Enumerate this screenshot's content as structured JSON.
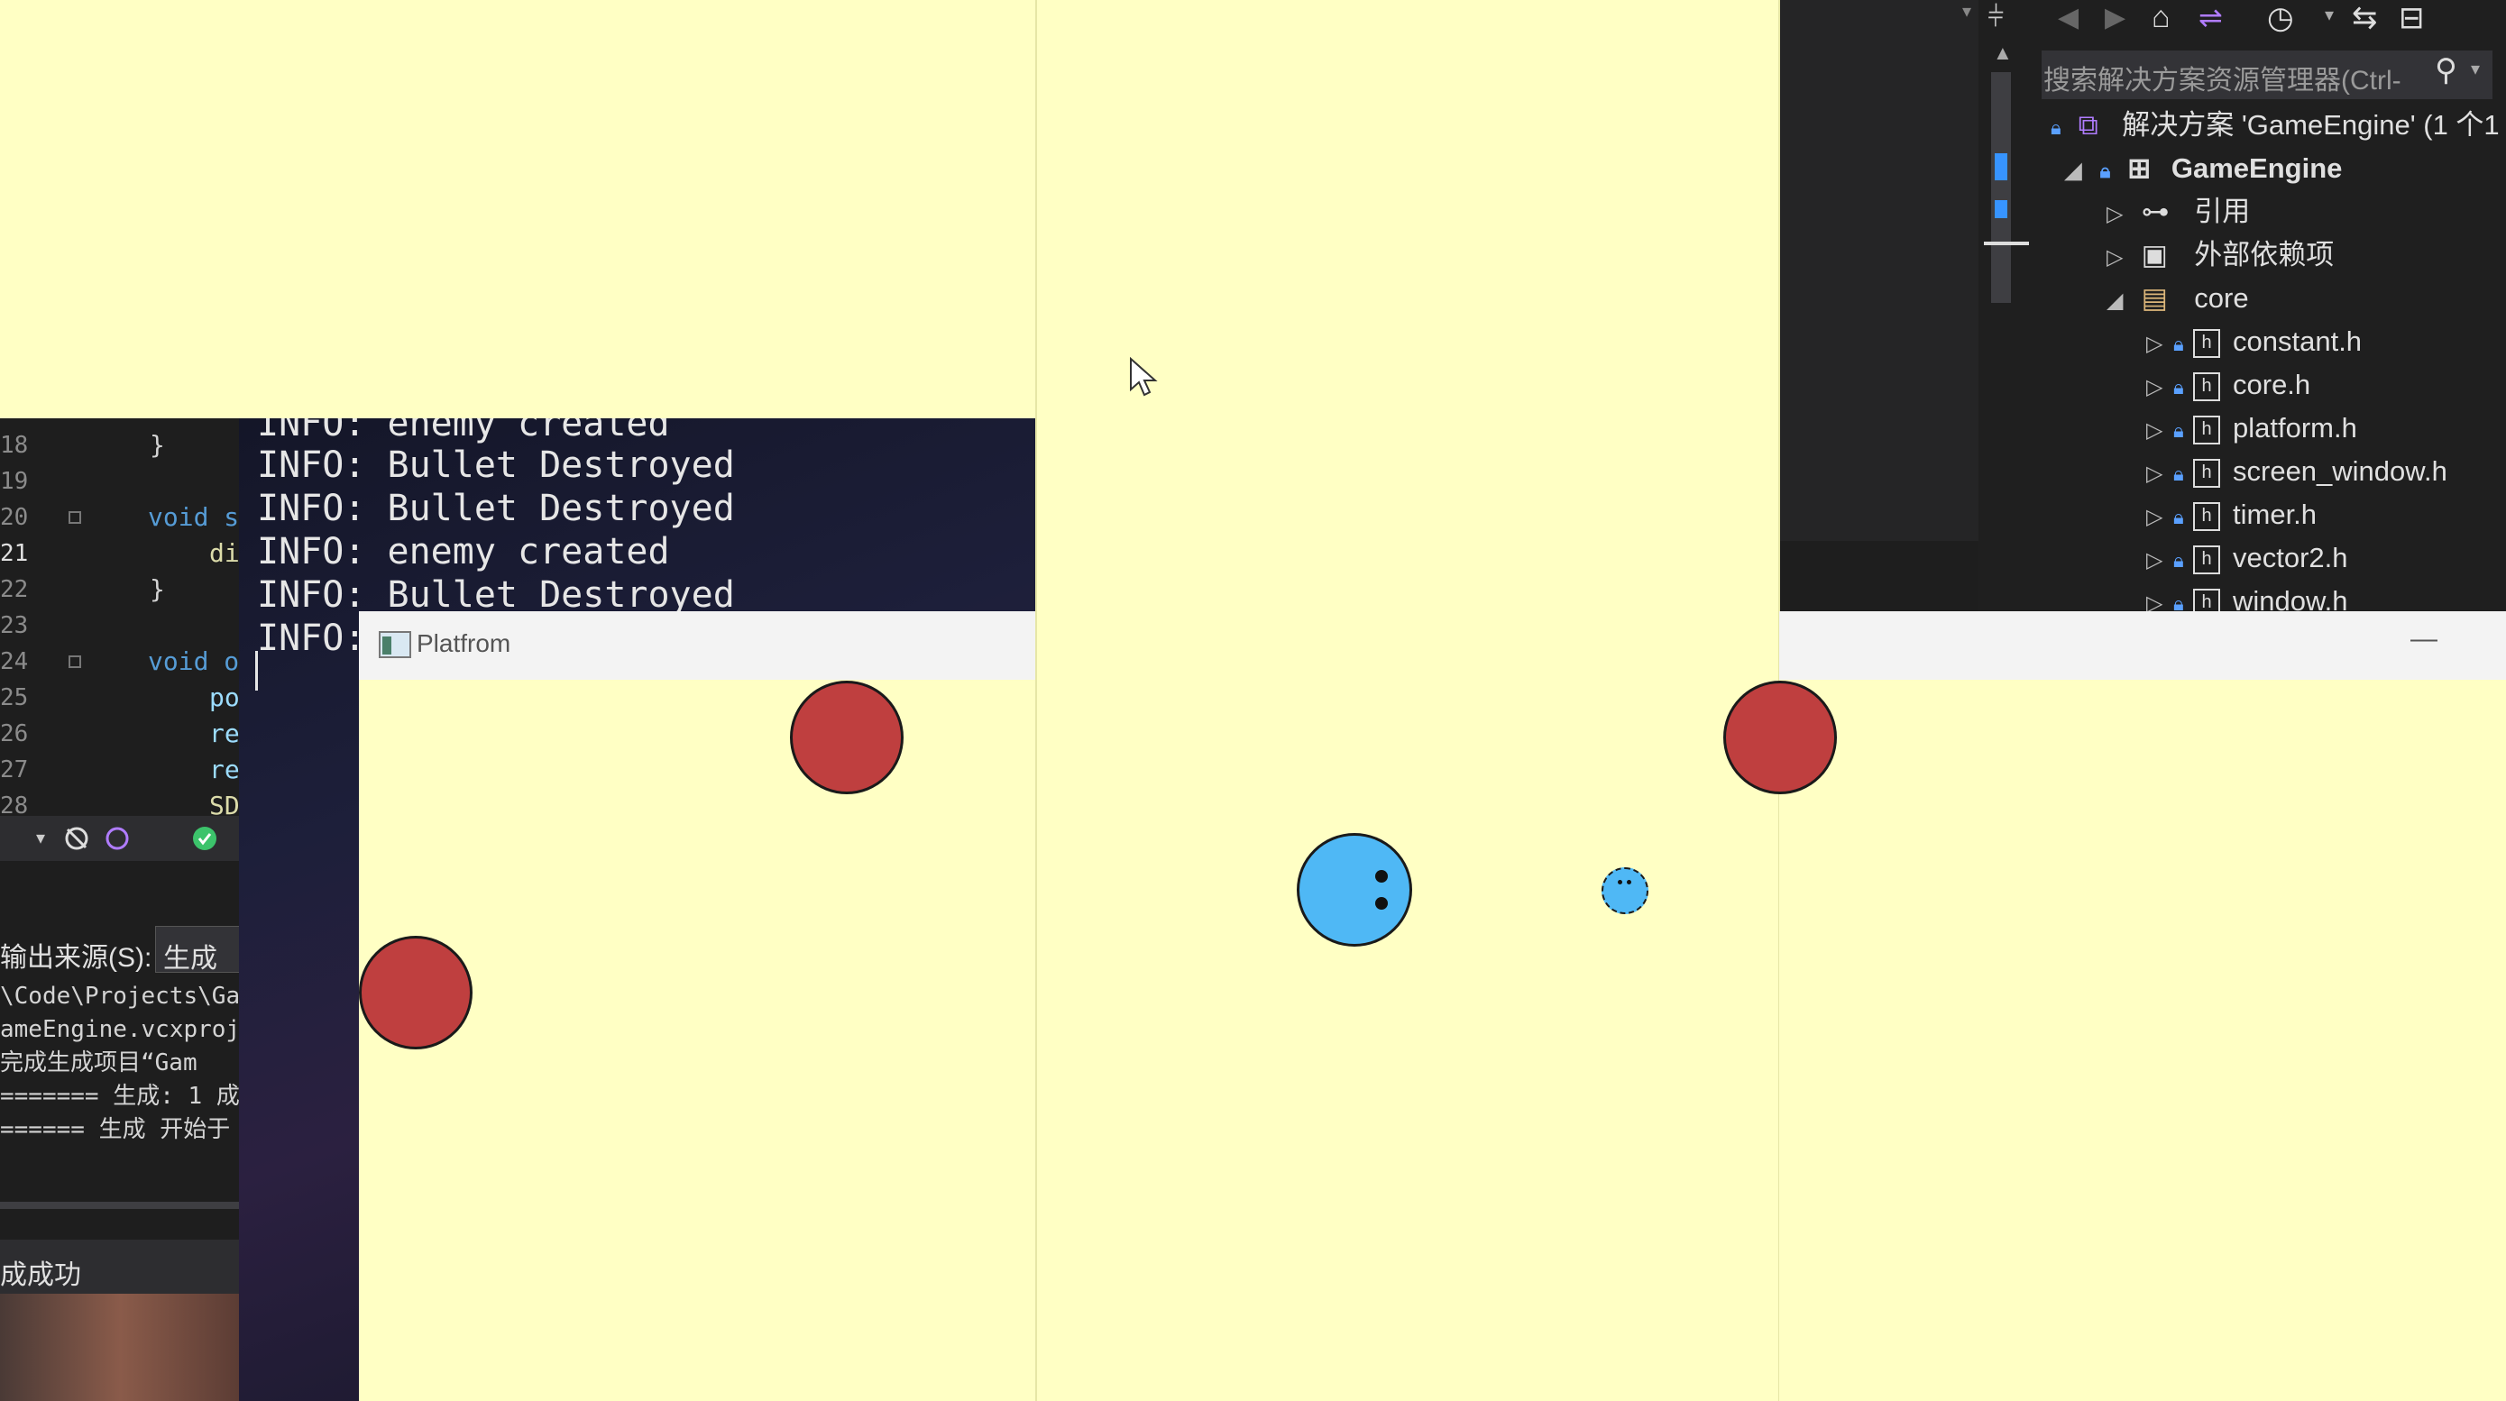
{
  "editor": {
    "lines": [
      {
        "num": "18",
        "code": "}"
      },
      {
        "num": "19",
        "code": ""
      },
      {
        "num": "20",
        "code": "void s"
      },
      {
        "num": "21",
        "code": "di"
      },
      {
        "num": "22",
        "code": "}"
      },
      {
        "num": "23",
        "code": ""
      },
      {
        "num": "24",
        "code": "void o"
      },
      {
        "num": "25",
        "code": "po"
      },
      {
        "num": "26",
        "code": "re"
      },
      {
        "num": "27",
        "code": "re"
      },
      {
        "num": "28",
        "code": "SD"
      }
    ]
  },
  "output": {
    "source_label": "输出来源(S):",
    "source_value": "生成",
    "lines": [
      "\\Code\\Projects\\Ga",
      "ameEngine.vcxproj",
      "完成生成项目“Gam",
      "======= 生成: 1 成",
      "====== 生成 开始于"
    ],
    "status": "成成功"
  },
  "console": {
    "lines": [
      "INFO: enemy created",
      "INFO: Bullet Destroyed",
      "INFO: Bullet Destroyed",
      "INFO: enemy created",
      "INFO: Bullet Destroyed",
      "INFO:"
    ]
  },
  "platform_window": {
    "title": "Platfrom",
    "minimize_glyph": "—"
  },
  "solution_explorer": {
    "search_placeholder": "搜索解决方案资源管理器(Ctrl-",
    "solution": "解决方案 'GameEngine' (1 个1",
    "project": "GameEngine",
    "references": "引用",
    "external": "外部依赖项",
    "folder": "core",
    "files": [
      "constant.h",
      "core.h",
      "platform.h",
      "screen_window.h",
      "timer.h",
      "vector2.h",
      "window.h"
    ]
  },
  "colors": {
    "background": "#ffffc4",
    "enemy": "#bf3f3f",
    "player": "#4fb8f5",
    "ide_bg": "#1e1e1e"
  }
}
